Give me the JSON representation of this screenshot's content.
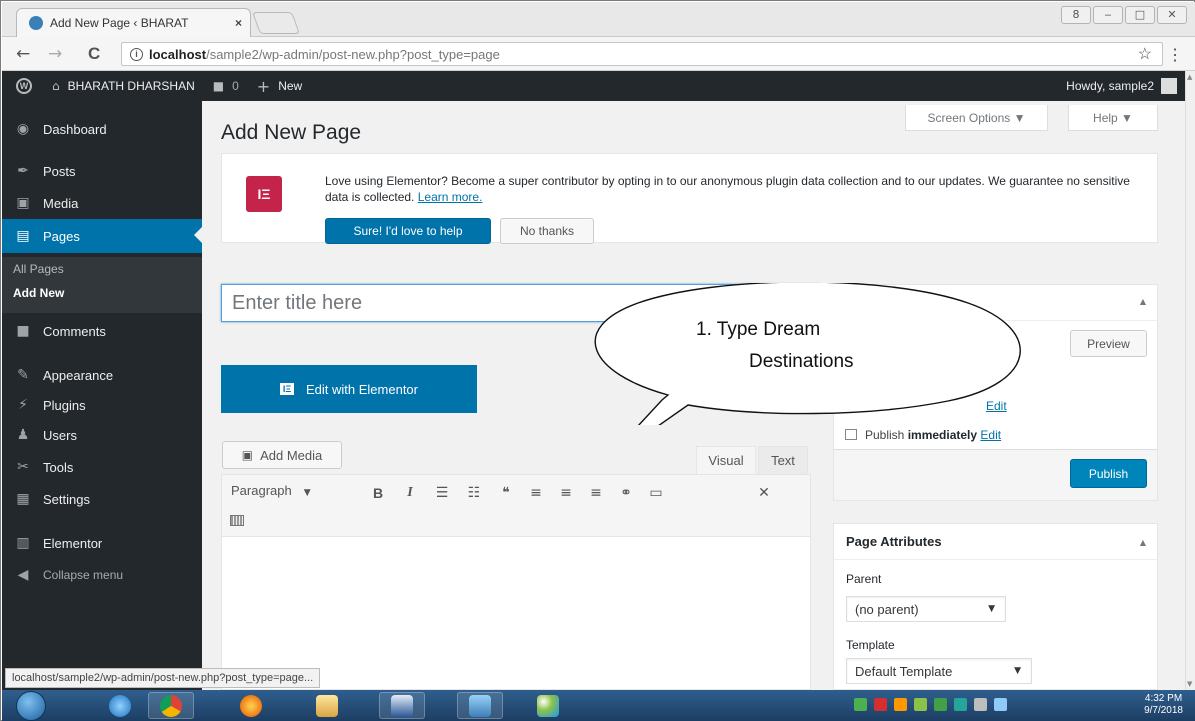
{
  "browser": {
    "tab_title": "Add New Page ‹ BHARAT",
    "tab_close": "×",
    "url_host": "localhost",
    "url_path": "/sample2/wp-admin/post-new.php?post_type=page",
    "back": "←",
    "forward": "→",
    "reload": "C",
    "star": "☆",
    "menu": "⋮",
    "win_min": "‒",
    "win_restore": "□",
    "win_close": "✕",
    "win_user": "8"
  },
  "adminbar": {
    "site_name": "BHARATH DHARSHAN",
    "comments_count": "0",
    "new_label": "New",
    "howdy": "Howdy, sample2",
    "home_icon": "⌂",
    "comment_icon": "■",
    "plus_icon": "+"
  },
  "sidebar": {
    "items": [
      {
        "label": "Dashboard",
        "icon": "dashboard-icon",
        "glyph": "◉"
      },
      {
        "label": "Posts",
        "icon": "pin-icon",
        "glyph": "✒"
      },
      {
        "label": "Media",
        "icon": "media-icon",
        "glyph": "▣"
      },
      {
        "label": "Pages",
        "icon": "pages-icon",
        "glyph": "▤"
      },
      {
        "label": "Comments",
        "icon": "comments-icon",
        "glyph": "■"
      },
      {
        "label": "Appearance",
        "icon": "brush-icon",
        "glyph": "✎"
      },
      {
        "label": "Plugins",
        "icon": "plug-icon",
        "glyph": "⚡"
      },
      {
        "label": "Users",
        "icon": "users-icon",
        "glyph": "♟"
      },
      {
        "label": "Tools",
        "icon": "wrench-icon",
        "glyph": "✂"
      },
      {
        "label": "Settings",
        "icon": "settings-icon",
        "glyph": "▦"
      },
      {
        "label": "Elementor",
        "icon": "elementor-icon",
        "glyph": "▥"
      },
      {
        "label": "Collapse menu",
        "icon": "collapse-icon",
        "glyph": "◀"
      }
    ],
    "submenu": [
      "All Pages",
      "Add New"
    ]
  },
  "header": {
    "screen_options": "Screen Options ▼",
    "help": "Help ▼",
    "page_title": "Add New Page"
  },
  "notice": {
    "logo_text": "IΞ",
    "text": "Love using Elementor? Become a super contributor by opting in to our anonymous plugin data collection and to our updates. We guarantee no sensitive data is collected.",
    "learn_more": "Learn more.",
    "sure_button": "Sure! I'd love to help",
    "no_button": "No thanks"
  },
  "editor": {
    "title_placeholder": "Enter title here",
    "edit_with_elementor": "Edit with Elementor",
    "elementor_icon_text": "IΞ",
    "add_media": "Add Media",
    "tab_visual": "Visual",
    "tab_text": "Text",
    "format_select": "Paragraph",
    "toolbar": [
      {
        "name": "bold-button",
        "glyph": "B",
        "cls": "b"
      },
      {
        "name": "italic-button",
        "glyph": "I",
        "cls": "i"
      },
      {
        "name": "bullet-list-button",
        "glyph": "☰",
        "cls": ""
      },
      {
        "name": "numbered-list-button",
        "glyph": "☷",
        "cls": ""
      },
      {
        "name": "blockquote-button",
        "glyph": "❝",
        "cls": ""
      },
      {
        "name": "align-left-button",
        "glyph": "≡",
        "cls": ""
      },
      {
        "name": "align-center-button",
        "glyph": "≡",
        "cls": ""
      },
      {
        "name": "align-right-button",
        "glyph": "≡",
        "cls": ""
      },
      {
        "name": "link-button",
        "glyph": "⚭",
        "cls": ""
      },
      {
        "name": "read-more-button",
        "glyph": "▭",
        "cls": ""
      },
      {
        "name": "fullscreen-button",
        "glyph": "✕",
        "cls": ""
      }
    ]
  },
  "publish_box": {
    "preview": "Preview",
    "visibility_edit": "Edit",
    "publish_prefix": "Publish",
    "publish_when": "immediately",
    "publish_edit": "Edit",
    "publish_button": "Publish",
    "toggle": "▲"
  },
  "attributes": {
    "title": "Page Attributes",
    "parent_label": "Parent",
    "parent_value": "(no parent)",
    "template_label": "Template",
    "template_value": "Default Template",
    "toggle": "▲",
    "caret": "▼"
  },
  "callout": {
    "line1": "1.    Type Dream",
    "line2": "Destinations"
  },
  "status_url": "localhost/sample2/wp-admin/post-new.php?post_type=page...",
  "taskbar": {
    "time": "4:32 PM",
    "date": "9/7/2018"
  },
  "colors": {
    "admin_dark": "#23282d",
    "wp_blue": "#0073aa",
    "elementor_red": "#c4234a"
  }
}
